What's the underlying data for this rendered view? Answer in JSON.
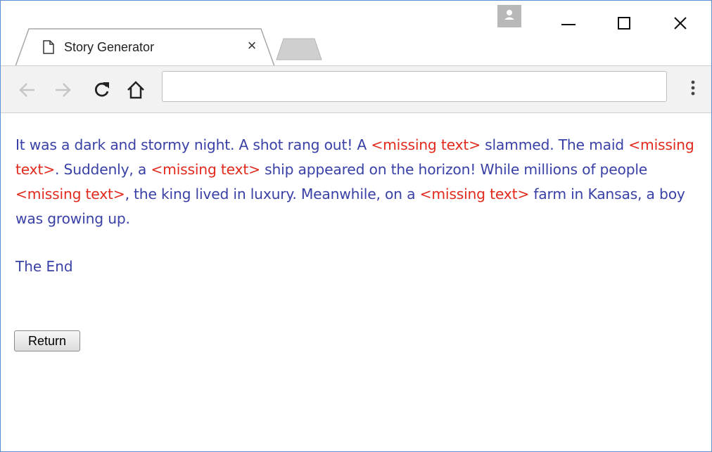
{
  "tab": {
    "title": "Story Generator",
    "close": "×"
  },
  "address_bar": {
    "value": "",
    "placeholder": ""
  },
  "window_controls": {
    "minimize": "minimize",
    "maximize": "maximize",
    "close": "close"
  },
  "story": {
    "segments": [
      {
        "text": "It was a dark and stormy night. A shot rang out! A ",
        "missing": false
      },
      {
        "text": "<missing text>",
        "missing": true
      },
      {
        "text": " slammed. The maid ",
        "missing": false
      },
      {
        "text": "<missing text>",
        "missing": true
      },
      {
        "text": ". Suddenly, a ",
        "missing": false
      },
      {
        "text": "<missing text>",
        "missing": true
      },
      {
        "text": " ship appeared on the horizon! While millions of people ",
        "missing": false
      },
      {
        "text": "<missing text>",
        "missing": true
      },
      {
        "text": ", the king lived in luxury. Meanwhile, on a ",
        "missing": false
      },
      {
        "text": "<missing text>",
        "missing": true
      },
      {
        "text": " farm in Kansas, a boy was growing up.",
        "missing": false
      }
    ],
    "ending": "The End"
  },
  "return_button": {
    "label": "Return"
  },
  "colors": {
    "story_text": "#3a41a6",
    "missing_text": "#e12a1d",
    "window_border": "#5b8fd6"
  }
}
